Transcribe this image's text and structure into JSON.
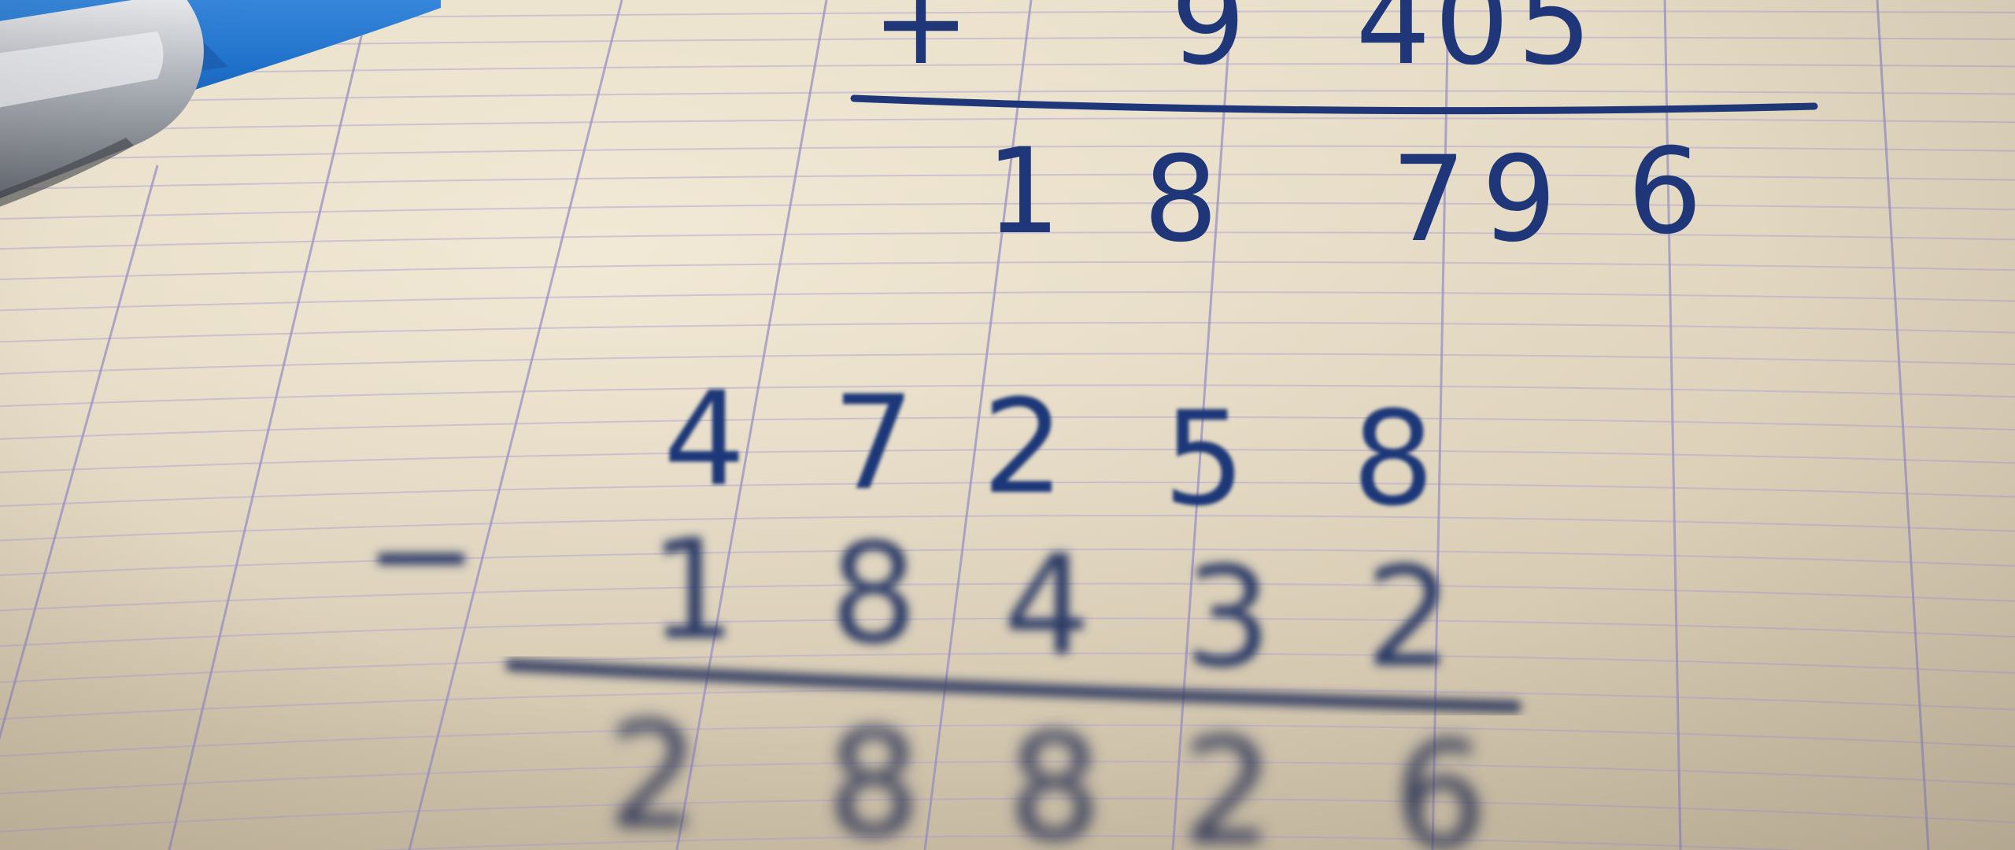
{
  "photo": {
    "subject": "handwritten arithmetic on grid paper with a pen",
    "colors": {
      "paper": "#e0d5bf",
      "grid": "#9a8fc4",
      "ink": "#1f3778",
      "pen_barrel": "#1e6fc8",
      "pen_metal": "#c9ccd1"
    }
  },
  "addition": {
    "operator": "+",
    "partial_addend": [
      "9",
      "4",
      "0",
      "5"
    ],
    "sum": [
      "1",
      "8",
      "7",
      "9",
      "6"
    ]
  },
  "subtraction": {
    "minuend": [
      "4",
      "7",
      "2",
      "5",
      "8"
    ],
    "operator": "−",
    "subtrahend": [
      "1",
      "8",
      "4",
      "3",
      "2"
    ],
    "difference": [
      "2",
      "8",
      "8",
      "2",
      "6"
    ]
  }
}
